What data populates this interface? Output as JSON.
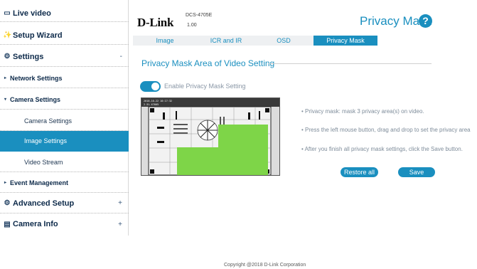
{
  "sidebar": {
    "live_video": "Live video",
    "setup_wizard": "Setup Wizard",
    "settings": "Settings",
    "settings_toggle": "-",
    "network_settings": "Network Settings",
    "camera_settings_group": "Camera Settings",
    "camera_settings": "Camera Settings",
    "image_settings": "Image Settings",
    "video_stream": "Video Stream",
    "event_management": "Event Management",
    "advanced_setup": "Advanced Setup",
    "advanced_toggle": "+",
    "camera_info": "Camera Info",
    "camera_info_toggle": "+"
  },
  "header": {
    "logo": "D-Link",
    "model": "DCS-4705E",
    "version": "1.00",
    "page_title": "Privacy Mask",
    "help": "?"
  },
  "tabs": [
    {
      "label": "Image",
      "active": false
    },
    {
      "label": "ICR and IR",
      "active": false
    },
    {
      "label": "OSD",
      "active": false
    },
    {
      "label": "Privacy Mask",
      "active": true
    }
  ],
  "section": {
    "title": "Privacy Mask Area of Video Setting",
    "enable_label": "Enable Privacy Mask Setting",
    "enabled": true
  },
  "video": {
    "timestamp_line1": "2018-10-22 10:17:32",
    "timestamp_line2": "2.5% 47665",
    "mask_color": "#7ed548"
  },
  "hints": [
    "Privacy mask: mask 3 privacy area(s) on video.",
    "Press the left mouse button, drag and drop to set the privacy area",
    "After you finish all privacy mask settings, click the Save button."
  ],
  "buttons": {
    "restore_all": "Restore all",
    "save": "Save"
  },
  "footer": "Copyright @2018 D-Link Corporation",
  "colors": {
    "accent": "#1a8fbf",
    "mask": "#7ed548"
  }
}
